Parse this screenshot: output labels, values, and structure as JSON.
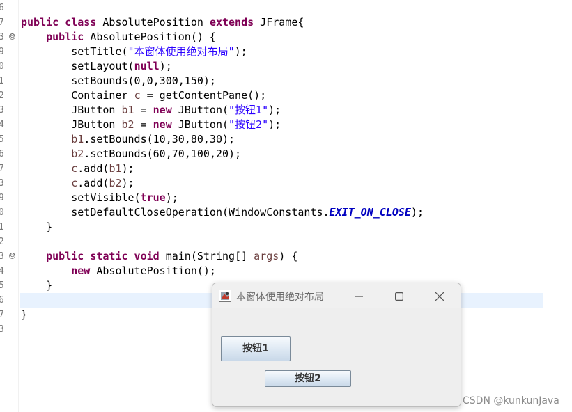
{
  "editor": {
    "line_numbers": [
      "6",
      "7",
      "3",
      "9",
      "0",
      "1",
      "2",
      "3",
      "4",
      "5",
      "6",
      "7",
      "3",
      "9",
      "0",
      "1",
      "2",
      "3",
      "4",
      "5",
      "6",
      "7",
      "3"
    ],
    "fold_marker": "⊖",
    "lines": [
      [],
      [
        {
          "t": "public class ",
          "c": "kw"
        },
        {
          "t": "AbsolutePosition",
          "c": "plain warn"
        },
        {
          "t": " ",
          "c": "plain"
        },
        {
          "t": "extends",
          "c": "kw"
        },
        {
          "t": " JFrame{",
          "c": "plain"
        }
      ],
      [
        {
          "t": "    ",
          "c": "plain"
        },
        {
          "t": "public",
          "c": "kw"
        },
        {
          "t": " AbsolutePosition() {",
          "c": "plain"
        }
      ],
      [
        {
          "t": "        setTitle(",
          "c": "plain"
        },
        {
          "t": "\"本窗体使用绝对布局\"",
          "c": "str"
        },
        {
          "t": ");",
          "c": "plain"
        }
      ],
      [
        {
          "t": "        setLayout(",
          "c": "plain"
        },
        {
          "t": "null",
          "c": "kw"
        },
        {
          "t": ");",
          "c": "plain"
        }
      ],
      [
        {
          "t": "        setBounds(0,0,300,150);",
          "c": "plain"
        }
      ],
      [
        {
          "t": "        Container ",
          "c": "plain"
        },
        {
          "t": "c",
          "c": "par"
        },
        {
          "t": " = getContentPane();",
          "c": "plain"
        }
      ],
      [
        {
          "t": "        JButton ",
          "c": "plain"
        },
        {
          "t": "b1",
          "c": "par"
        },
        {
          "t": " = ",
          "c": "plain"
        },
        {
          "t": "new",
          "c": "kw"
        },
        {
          "t": " JButton(",
          "c": "plain"
        },
        {
          "t": "\"按钮1\"",
          "c": "str"
        },
        {
          "t": ");",
          "c": "plain"
        }
      ],
      [
        {
          "t": "        JButton ",
          "c": "plain"
        },
        {
          "t": "b2",
          "c": "par"
        },
        {
          "t": " = ",
          "c": "plain"
        },
        {
          "t": "new",
          "c": "kw"
        },
        {
          "t": " JButton(",
          "c": "plain"
        },
        {
          "t": "\"按钮2\"",
          "c": "str"
        },
        {
          "t": ");",
          "c": "plain"
        }
      ],
      [
        {
          "t": "        ",
          "c": "plain"
        },
        {
          "t": "b1",
          "c": "par"
        },
        {
          "t": ".setBounds(10,30,80,30);",
          "c": "plain"
        }
      ],
      [
        {
          "t": "        ",
          "c": "plain"
        },
        {
          "t": "b2",
          "c": "par"
        },
        {
          "t": ".setBounds(60,70,100,20);",
          "c": "plain"
        }
      ],
      [
        {
          "t": "        ",
          "c": "plain"
        },
        {
          "t": "c",
          "c": "par"
        },
        {
          "t": ".add(",
          "c": "plain"
        },
        {
          "t": "b1",
          "c": "par"
        },
        {
          "t": ");",
          "c": "plain"
        }
      ],
      [
        {
          "t": "        ",
          "c": "plain"
        },
        {
          "t": "c",
          "c": "par"
        },
        {
          "t": ".add(",
          "c": "plain"
        },
        {
          "t": "b2",
          "c": "par"
        },
        {
          "t": ");",
          "c": "plain"
        }
      ],
      [
        {
          "t": "        setVisible(",
          "c": "plain"
        },
        {
          "t": "true",
          "c": "kw"
        },
        {
          "t": ");",
          "c": "plain"
        }
      ],
      [
        {
          "t": "        setDefaultCloseOperation(WindowConstants.",
          "c": "plain"
        },
        {
          "t": "EXIT_ON_CLOSE",
          "c": "cst"
        },
        {
          "t": ");",
          "c": "plain"
        }
      ],
      [
        {
          "t": "    }",
          "c": "plain"
        }
      ],
      [],
      [
        {
          "t": "    ",
          "c": "plain"
        },
        {
          "t": "public static void",
          "c": "kw"
        },
        {
          "t": " main(String[] ",
          "c": "plain"
        },
        {
          "t": "args",
          "c": "par"
        },
        {
          "t": ") {",
          "c": "plain"
        }
      ],
      [
        {
          "t": "        ",
          "c": "plain"
        },
        {
          "t": "new",
          "c": "kw"
        },
        {
          "t": " AbsolutePosition();",
          "c": "plain"
        }
      ],
      [
        {
          "t": "    }",
          "c": "plain"
        }
      ],
      [],
      [
        {
          "t": "}",
          "c": "plain"
        }
      ],
      []
    ],
    "fold_lines": [
      2,
      17
    ],
    "current_line": 19
  },
  "window": {
    "title": "本窗体使用绝对布局",
    "minimize_icon": "minimize-icon",
    "maximize_icon": "maximize-icon",
    "close_icon": "close-icon",
    "button1_label": "按钮1",
    "button2_label": "按钮2"
  },
  "watermark": "CSDN @kunkunJava",
  "colors": {
    "keyword": "#7f0055",
    "string": "#2a00ff",
    "constant": "#0000c0",
    "current_line": "#e8f2fe"
  }
}
